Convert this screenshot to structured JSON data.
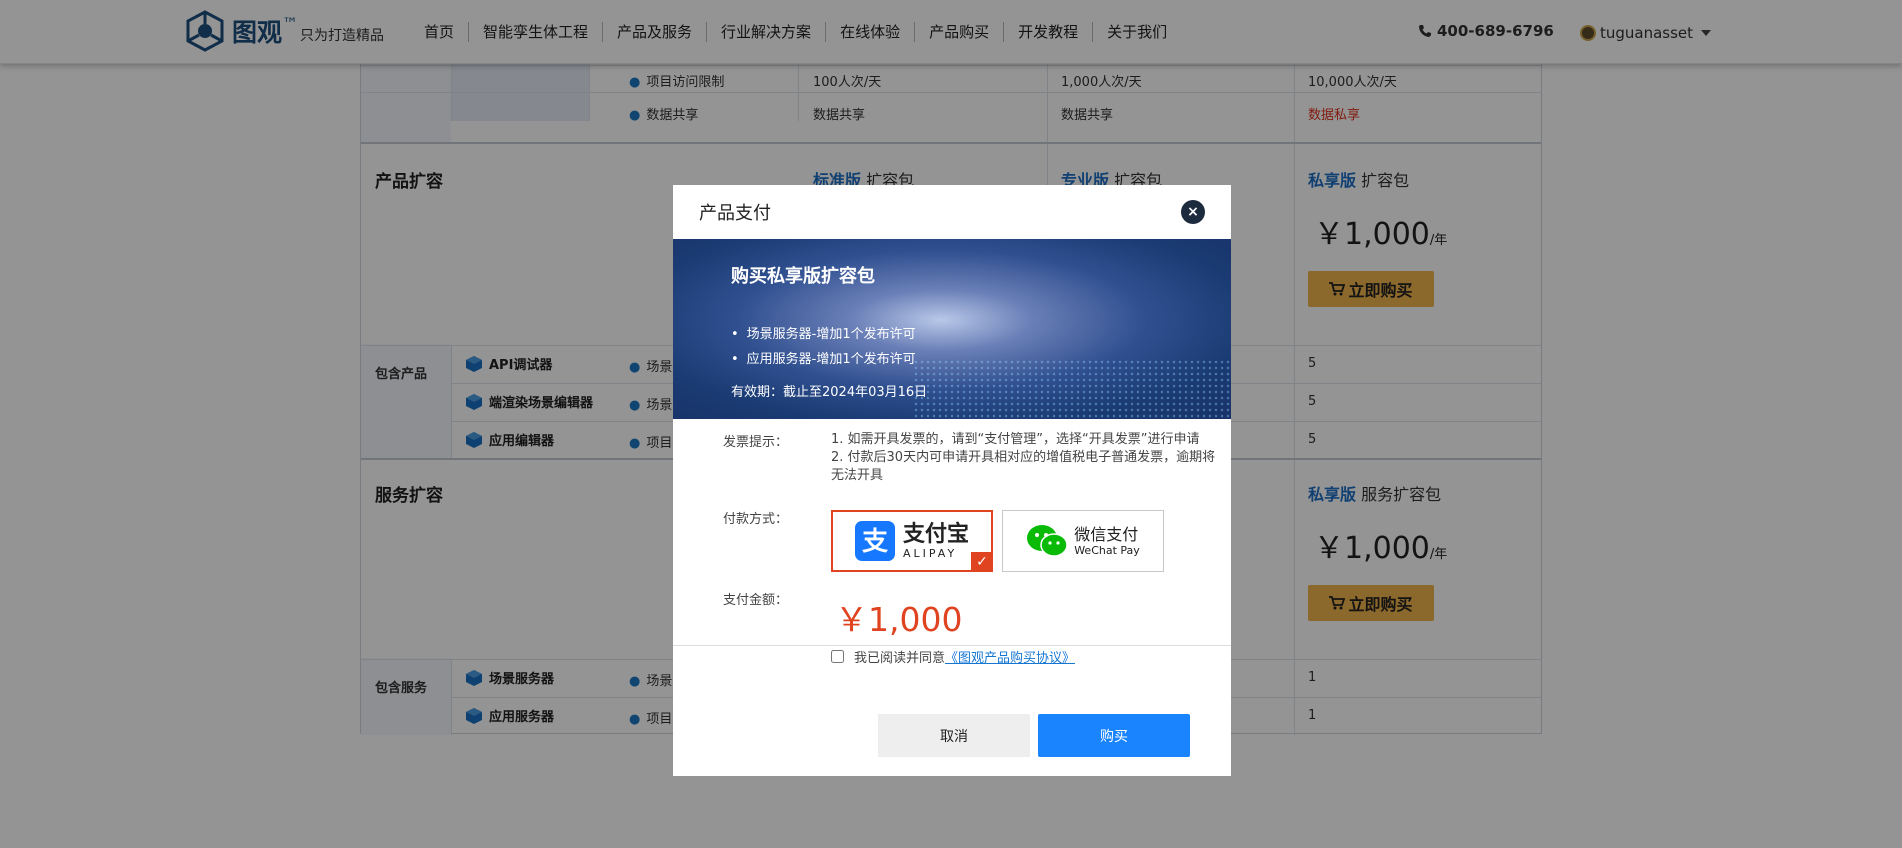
{
  "header": {
    "logo_name": "图观",
    "logo_tm": "™",
    "logo_slogan": "只为打造精品",
    "nav": [
      "首页",
      "智能孪生体工程",
      "产品及服务",
      "行业解决方案",
      "在线体验",
      "产品购买",
      "开发教程",
      "关于我们"
    ],
    "phone": "400-689-6796",
    "username": "tuguanasset"
  },
  "table": {
    "top_rows": [
      {
        "label": "项目访问限制",
        "std": "100人次/天",
        "pro": "1,000人次/天",
        "pri": "10,000人次/天"
      },
      {
        "label": "数据共享",
        "std": "数据共享",
        "pro": "数据共享",
        "pri": "数据私享"
      }
    ],
    "product_expand": {
      "title": "产品扩容",
      "std_name": "标准版",
      "pro_name": "专业版",
      "pri_name": "私享版",
      "pkg_suffix": "扩容包",
      "price": "￥1,000",
      "unit": "/年",
      "buy_label": "立即购买"
    },
    "included_products": {
      "title": "包含产品",
      "items": [
        {
          "name": "API调试器",
          "sub": "场景"
        },
        {
          "name": "端渲染场景编辑器",
          "sub": "场景"
        },
        {
          "name": "应用编辑器",
          "sub": "项目"
        }
      ],
      "pri_values": [
        "5",
        "5",
        "5"
      ]
    },
    "service_expand": {
      "title": "服务扩容",
      "pri_name": "私享版",
      "pkg_suffix": "服务扩容包",
      "price": "￥1,000",
      "unit": "/年",
      "buy_label": "立即购买"
    },
    "included_services": {
      "title": "包含服务",
      "items": [
        {
          "name": "场景服务器",
          "sub": "场景"
        },
        {
          "name": "应用服务器",
          "sub": "项目"
        }
      ],
      "pri_values": [
        "1",
        "1"
      ]
    }
  },
  "modal": {
    "title": "产品支付",
    "close_icon": "×",
    "banner": {
      "title": "购买私享版扩容包",
      "items": [
        "场景服务器-增加1个发布许可",
        "应用服务器-增加1个发布许可"
      ],
      "validity": "有效期：截止至2024年03月16日"
    },
    "invoice_label": "发票提示：",
    "invoice_tips": [
      "1. 如需开具发票的，请到“支付管理”，选择“开具发票”进行申请",
      "2. 付款后30天内可申请开具相对应的增值税电子普通发票，逾期将无法开具"
    ],
    "payment_label": "付款方式：",
    "alipay_cn": "支付宝",
    "alipay_en": "ALIPAY",
    "wechat_cn": "微信支付",
    "wechat_en": "WeChat Pay",
    "amount_label": "支付金额：",
    "amount": "￥1,000",
    "agree_text": "我已阅读并同意",
    "agree_link": "《图观产品购买协议》",
    "cancel_label": "取消",
    "buy_label": "购买"
  },
  "colors": {
    "accent": "#1a84ff",
    "alipay": "#1677ff",
    "wechat": "#09bb07",
    "price_red": "#e0431f",
    "buy_gold": "#f0b34a"
  }
}
